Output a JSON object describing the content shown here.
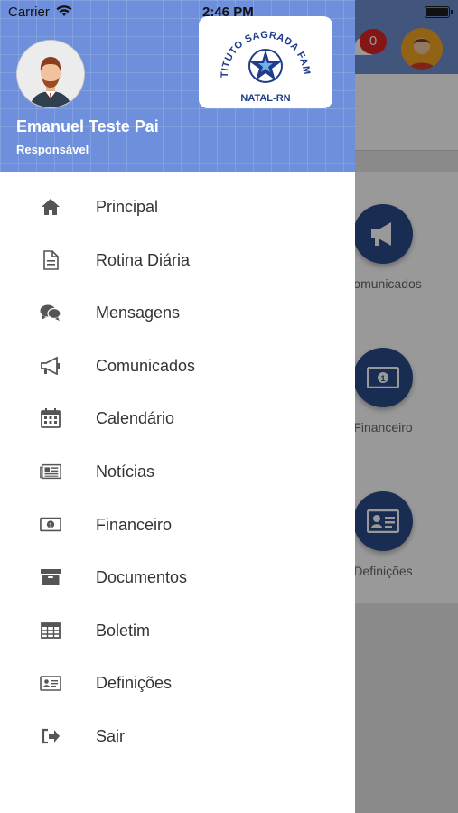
{
  "status_bar": {
    "carrier": "Carrier",
    "time": "2:46 PM"
  },
  "background": {
    "notification_count": "0",
    "tiles": [
      {
        "label": "Comunicados",
        "icon": "megaphone-icon"
      },
      {
        "label": "Financeiro",
        "icon": "money-icon"
      },
      {
        "label": "Definições",
        "icon": "id-card-icon"
      }
    ]
  },
  "drawer": {
    "user_name": "Emanuel Teste Pai",
    "user_role": "Responsável",
    "logo": {
      "top_text": "INSTITUTO SAGRADA FAMÍLIA",
      "bottom_text": "NATAL-RN"
    },
    "menu": [
      {
        "label": "Principal",
        "icon": "home-icon"
      },
      {
        "label": "Rotina Diária",
        "icon": "document-icon"
      },
      {
        "label": "Mensagens",
        "icon": "chat-icon"
      },
      {
        "label": "Comunicados",
        "icon": "megaphone-icon"
      },
      {
        "label": "Calendário",
        "icon": "calendar-icon"
      },
      {
        "label": "Notícias",
        "icon": "newspaper-icon"
      },
      {
        "label": "Financeiro",
        "icon": "money-icon"
      },
      {
        "label": "Documentos",
        "icon": "archive-icon"
      },
      {
        "label": "Boletim",
        "icon": "table-icon"
      },
      {
        "label": "Definições",
        "icon": "id-card-icon"
      },
      {
        "label": "Sair",
        "icon": "sign-out-icon"
      }
    ]
  },
  "colors": {
    "header_blue": "#6d8fdc",
    "tile_navy": "#2b4a88",
    "badge_red": "#e02424"
  }
}
